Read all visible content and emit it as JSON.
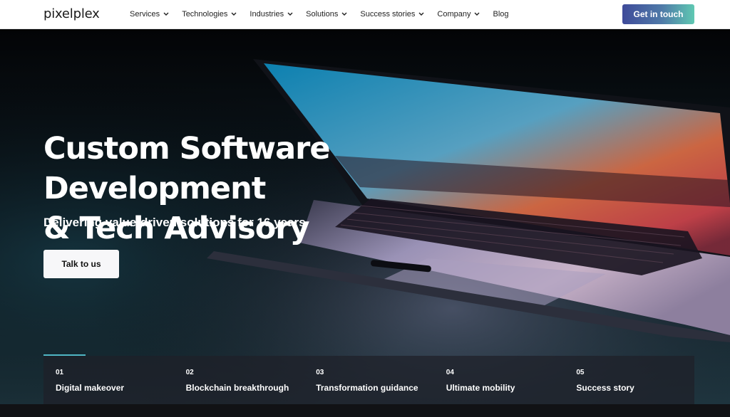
{
  "brand": {
    "logo": "pixelplex"
  },
  "nav": {
    "items": [
      {
        "label": "Services",
        "dropdown": true
      },
      {
        "label": "Technologies",
        "dropdown": true
      },
      {
        "label": "Industries",
        "dropdown": true
      },
      {
        "label": "Solutions",
        "dropdown": true
      },
      {
        "label": "Success stories",
        "dropdown": true
      },
      {
        "label": "Company",
        "dropdown": true
      },
      {
        "label": "Blog",
        "dropdown": false
      }
    ],
    "cta_label": "Get in touch"
  },
  "hero": {
    "title_line1": "Custom Software Development",
    "title_line2": "& Tech Advisory",
    "subtitle": "Delivering value-driven solutions for 16 years",
    "button_label": "Talk to us"
  },
  "stories": {
    "items": [
      {
        "number": "01",
        "title": "Digital makeover"
      },
      {
        "number": "02",
        "title": "Blockchain breakthrough"
      },
      {
        "number": "03",
        "title": "Transformation guidance"
      },
      {
        "number": "04",
        "title": "Ultimate mobility"
      },
      {
        "number": "05",
        "title": "Success story"
      }
    ]
  },
  "colors": {
    "cta_gradient_start": "#3f4b9a",
    "cta_gradient_end": "#5fc8b2",
    "progress_accent": "#4fb6c4",
    "hero_background": "#030406"
  }
}
